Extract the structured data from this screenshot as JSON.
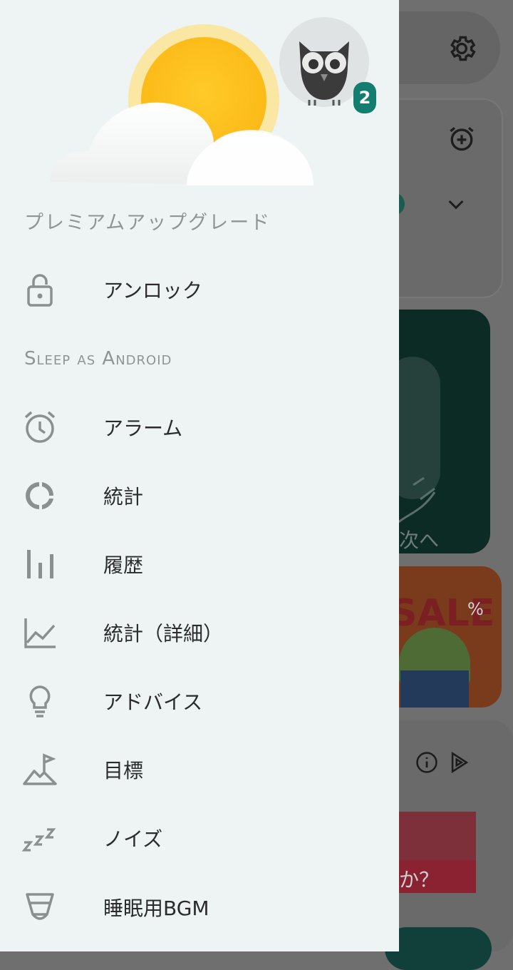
{
  "background": {
    "sale_text": "SALE",
    "sale_percent": "%",
    "next_text": "次へ",
    "question_text": "か？"
  },
  "drawer": {
    "badge_count": "2",
    "premium_section": "プレミアムアップグレード",
    "unlock_label": "アンロック",
    "app_section": "Sleep as Android",
    "items": [
      {
        "label": "アラーム",
        "icon": "alarm-clock-icon"
      },
      {
        "label": "統計",
        "icon": "donut-chart-icon"
      },
      {
        "label": "履歴",
        "icon": "bar-chart-icon"
      },
      {
        "label": "統計（詳細）",
        "icon": "line-chart-icon"
      },
      {
        "label": "アドバイス",
        "icon": "lightbulb-icon"
      },
      {
        "label": "目標",
        "icon": "mountain-flag-icon"
      },
      {
        "label": "ノイズ",
        "icon": "zzz-icon"
      },
      {
        "label": "睡眠用BGM",
        "icon": "lullaby-cup-icon"
      }
    ]
  },
  "colors": {
    "drawer_bg": "#eef3f3",
    "badge": "#137e70",
    "icon_gray": "#8a8f8f",
    "text": "#2b2b2b"
  }
}
